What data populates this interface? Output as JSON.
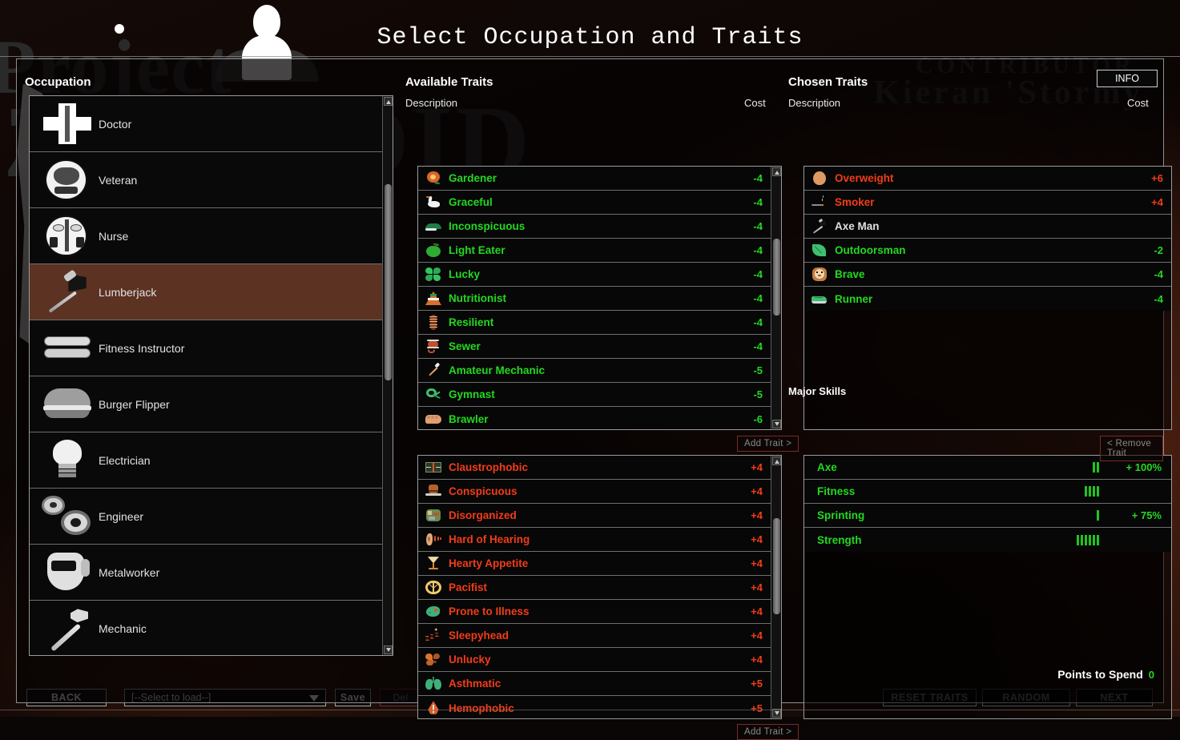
{
  "title": "Select Occupation and Traits",
  "background": {
    "watermark_top": "Project",
    "watermark_bottom": "ZOMBOID",
    "contributor_label": "CONTRIBUTOR",
    "contributor_name": "Kieran 'Stormy'"
  },
  "info_button": "INFO",
  "occupation": {
    "title": "Occupation",
    "selected": "Lumberjack",
    "items": [
      {
        "label": "Doctor",
        "icon": "medical-cross-icon"
      },
      {
        "label": "Veteran",
        "icon": "military-seal-icon"
      },
      {
        "label": "Nurse",
        "icon": "caduceus-rn-icon"
      },
      {
        "label": "Lumberjack",
        "icon": "axe-icon"
      },
      {
        "label": "Fitness Instructor",
        "icon": "towel-icon"
      },
      {
        "label": "Burger Flipper",
        "icon": "burger-icon"
      },
      {
        "label": "Electrician",
        "icon": "lightbulb-icon"
      },
      {
        "label": "Engineer",
        "icon": "gears-icon"
      },
      {
        "label": "Metalworker",
        "icon": "welding-mask-icon"
      },
      {
        "label": "Mechanic",
        "icon": "wrench-icon"
      }
    ]
  },
  "available_traits": {
    "title": "Available Traits",
    "col_description": "Description",
    "col_cost": "Cost",
    "add_trait_label": "Add Trait >",
    "positive": [
      {
        "name": "Gardener",
        "cost": "-4",
        "icon": "flower-icon"
      },
      {
        "name": "Graceful",
        "cost": "-4",
        "icon": "swan-icon"
      },
      {
        "name": "Inconspicuous",
        "cost": "-4",
        "icon": "leaf-cap-icon"
      },
      {
        "name": "Light Eater",
        "cost": "-4",
        "icon": "apple-icon"
      },
      {
        "name": "Lucky",
        "cost": "-4",
        "icon": "clover-icon"
      },
      {
        "name": "Nutritionist",
        "cost": "-4",
        "icon": "food-pyramid-icon"
      },
      {
        "name": "Resilient",
        "cost": "-4",
        "icon": "spine-icon"
      },
      {
        "name": "Sewer",
        "cost": "-4",
        "icon": "thread-spool-icon"
      },
      {
        "name": "Amateur Mechanic",
        "cost": "-5",
        "icon": "screwdriver-icon"
      },
      {
        "name": "Gymnast",
        "cost": "-5",
        "icon": "gymnast-icon"
      },
      {
        "name": "Brawler",
        "cost": "-6",
        "icon": "fist-icon"
      }
    ],
    "negative": [
      {
        "name": "Claustrophobic",
        "cost": "+4",
        "icon": "narrow-space-icon"
      },
      {
        "name": "Conspicuous",
        "cost": "+4",
        "icon": "top-hat-icon"
      },
      {
        "name": "Disorganized",
        "cost": "+4",
        "icon": "messy-bag-icon"
      },
      {
        "name": "Hard of Hearing",
        "cost": "+4",
        "icon": "ear-icon"
      },
      {
        "name": "Hearty Appetite",
        "cost": "+4",
        "icon": "drink-glass-icon"
      },
      {
        "name": "Pacifist",
        "cost": "+4",
        "icon": "peace-icon"
      },
      {
        "name": "Prone to Illness",
        "cost": "+4",
        "icon": "virus-icon"
      },
      {
        "name": "Sleepyhead",
        "cost": "+4",
        "icon": "zzz-icon"
      },
      {
        "name": "Unlucky",
        "cost": "+4",
        "icon": "broken-clover-icon"
      },
      {
        "name": "Asthmatic",
        "cost": "+5",
        "icon": "lungs-icon"
      },
      {
        "name": "Hemophobic",
        "cost": "+5",
        "icon": "blood-drop-icon"
      }
    ]
  },
  "chosen_traits": {
    "title": "Chosen Traits",
    "col_description": "Description",
    "col_cost": "Cost",
    "remove_trait_label": "< Remove Trait",
    "items": [
      {
        "name": "Overweight",
        "cost": "+6",
        "kind": "neg",
        "icon": "belly-icon"
      },
      {
        "name": "Smoker",
        "cost": "+4",
        "kind": "neg",
        "icon": "cigarette-icon"
      },
      {
        "name": "Axe Man",
        "cost": "",
        "kind": "neu",
        "icon": "axe-icon"
      },
      {
        "name": "Outdoorsman",
        "cost": "-2",
        "kind": "pos",
        "icon": "leaf-icon"
      },
      {
        "name": "Brave",
        "cost": "-4",
        "kind": "pos",
        "icon": "lion-icon"
      },
      {
        "name": "Runner",
        "cost": "-4",
        "kind": "pos",
        "icon": "shoe-icon"
      }
    ]
  },
  "major_skills": {
    "title": "Major Skills",
    "items": [
      {
        "name": "Axe",
        "bars": 2,
        "percent": "+ 100%"
      },
      {
        "name": "Fitness",
        "bars": 4,
        "percent": ""
      },
      {
        "name": "Sprinting",
        "bars": 1,
        "percent": "+ 75%"
      },
      {
        "name": "Strength",
        "bars": 6,
        "percent": ""
      }
    ]
  },
  "footer": {
    "back": "BACK",
    "load_placeholder": "[--Select to load--]",
    "save": "Save",
    "del": "Del",
    "reset_traits": "RESET TRAITS",
    "random": "RANDOM",
    "next": "NEXT",
    "points_label": "Points to Spend",
    "points_value": "0"
  }
}
